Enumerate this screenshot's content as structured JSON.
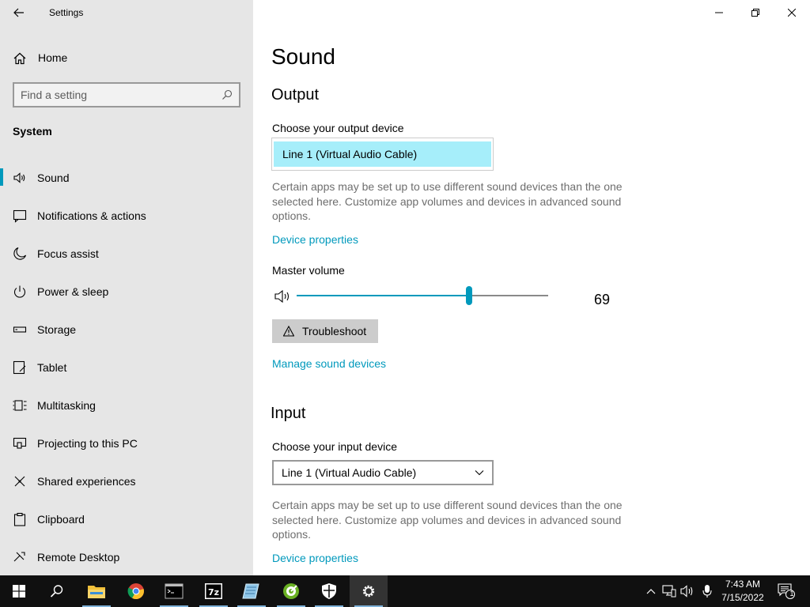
{
  "app": {
    "title": "Settings"
  },
  "sidebar": {
    "home_label": "Home",
    "search_placeholder": "Find a setting",
    "section": "System",
    "items": [
      {
        "label": "Sound",
        "icon": "speaker-icon",
        "selected": true
      },
      {
        "label": "Notifications & actions",
        "icon": "notifications-icon"
      },
      {
        "label": "Focus assist",
        "icon": "moon-icon"
      },
      {
        "label": "Power & sleep",
        "icon": "power-icon"
      },
      {
        "label": "Storage",
        "icon": "storage-icon"
      },
      {
        "label": "Tablet",
        "icon": "tablet-icon"
      },
      {
        "label": "Multitasking",
        "icon": "multitasking-icon"
      },
      {
        "label": "Projecting to this PC",
        "icon": "projecting-icon"
      },
      {
        "label": "Shared experiences",
        "icon": "shared-experiences-icon"
      },
      {
        "label": "Clipboard",
        "icon": "clipboard-icon"
      },
      {
        "label": "Remote Desktop",
        "icon": "remote-desktop-icon"
      }
    ]
  },
  "main": {
    "title": "Sound",
    "output": {
      "heading": "Output",
      "device_label": "Choose your output device",
      "device_value": "Line 1 (Virtual Audio Cable)",
      "description": "Certain apps may be set up to use different sound devices than the one selected here. Customize app volumes and devices in advanced sound options.",
      "device_properties_link": "Device properties",
      "master_volume_label": "Master volume",
      "volume": 69,
      "volume_display": "69",
      "troubleshoot_label": "Troubleshoot",
      "manage_link": "Manage sound devices"
    },
    "input": {
      "heading": "Input",
      "device_label": "Choose your input device",
      "device_value": "Line 1 (Virtual Audio Cable)",
      "description": "Certain apps may be set up to use different sound devices than the one selected here. Customize app volumes and devices in advanced sound options.",
      "device_properties_link": "Device properties"
    }
  },
  "taskbar": {
    "time": "7:43 AM",
    "date": "7/15/2022",
    "notification_count": "1",
    "apps": [
      "start-icon",
      "search-icon",
      "file-explorer-icon",
      "chrome-icon",
      "terminal-icon",
      "7zip-icon",
      "notepad-icon",
      "app-icon",
      "security-icon",
      "settings-icon"
    ]
  },
  "colors": {
    "accent": "#0099bc",
    "sidebar_bg": "#e6e6e6",
    "selected_option": "#a6eefa",
    "taskbar": "#101010"
  }
}
